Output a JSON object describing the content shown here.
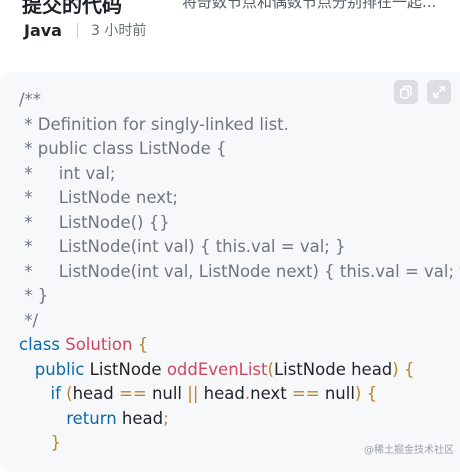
{
  "header": {
    "title": "提交的代码",
    "description": "将奇数节点和偶数节点分别排在一起..."
  },
  "meta": {
    "language": "Java",
    "time": "3 小时前"
  },
  "toolbar": {
    "copy_icon": "copy-icon",
    "expand_icon": "expand-icon"
  },
  "code": {
    "c1": "/**",
    "c2": " * Definition for singly-linked list.",
    "c3": " * public class ListNode {",
    "c4": " *     int val;",
    "c5": " *     ListNode next;",
    "c6": " *     ListNode() {}",
    "c7": " *     ListNode(int val) { this.val = val; }",
    "c8": " *     ListNode(int val, ListNode next) { this.val = val; this.next = next; }",
    "c9": " * }",
    "c10": " */",
    "class_kw": "class",
    "class_name": "Solution",
    "brace_open": " {",
    "public_kw": "public",
    "ret_type": "ListNode",
    "method_name": "oddEvenList",
    "paren_open": "(",
    "param": "ListNode head",
    "paren_close": ")",
    "if_kw": "if",
    "head1": "head",
    "eq1": "==",
    "null1": "null",
    "or_op": "||",
    "head2": "head",
    "dot": ".",
    "next": "next",
    "eq2": "==",
    "null2": "null",
    "return_kw": "return",
    "ret_head": "head",
    "semi": ";",
    "brace_close": "}"
  },
  "watermark": "@稀土掘金技术社区"
}
